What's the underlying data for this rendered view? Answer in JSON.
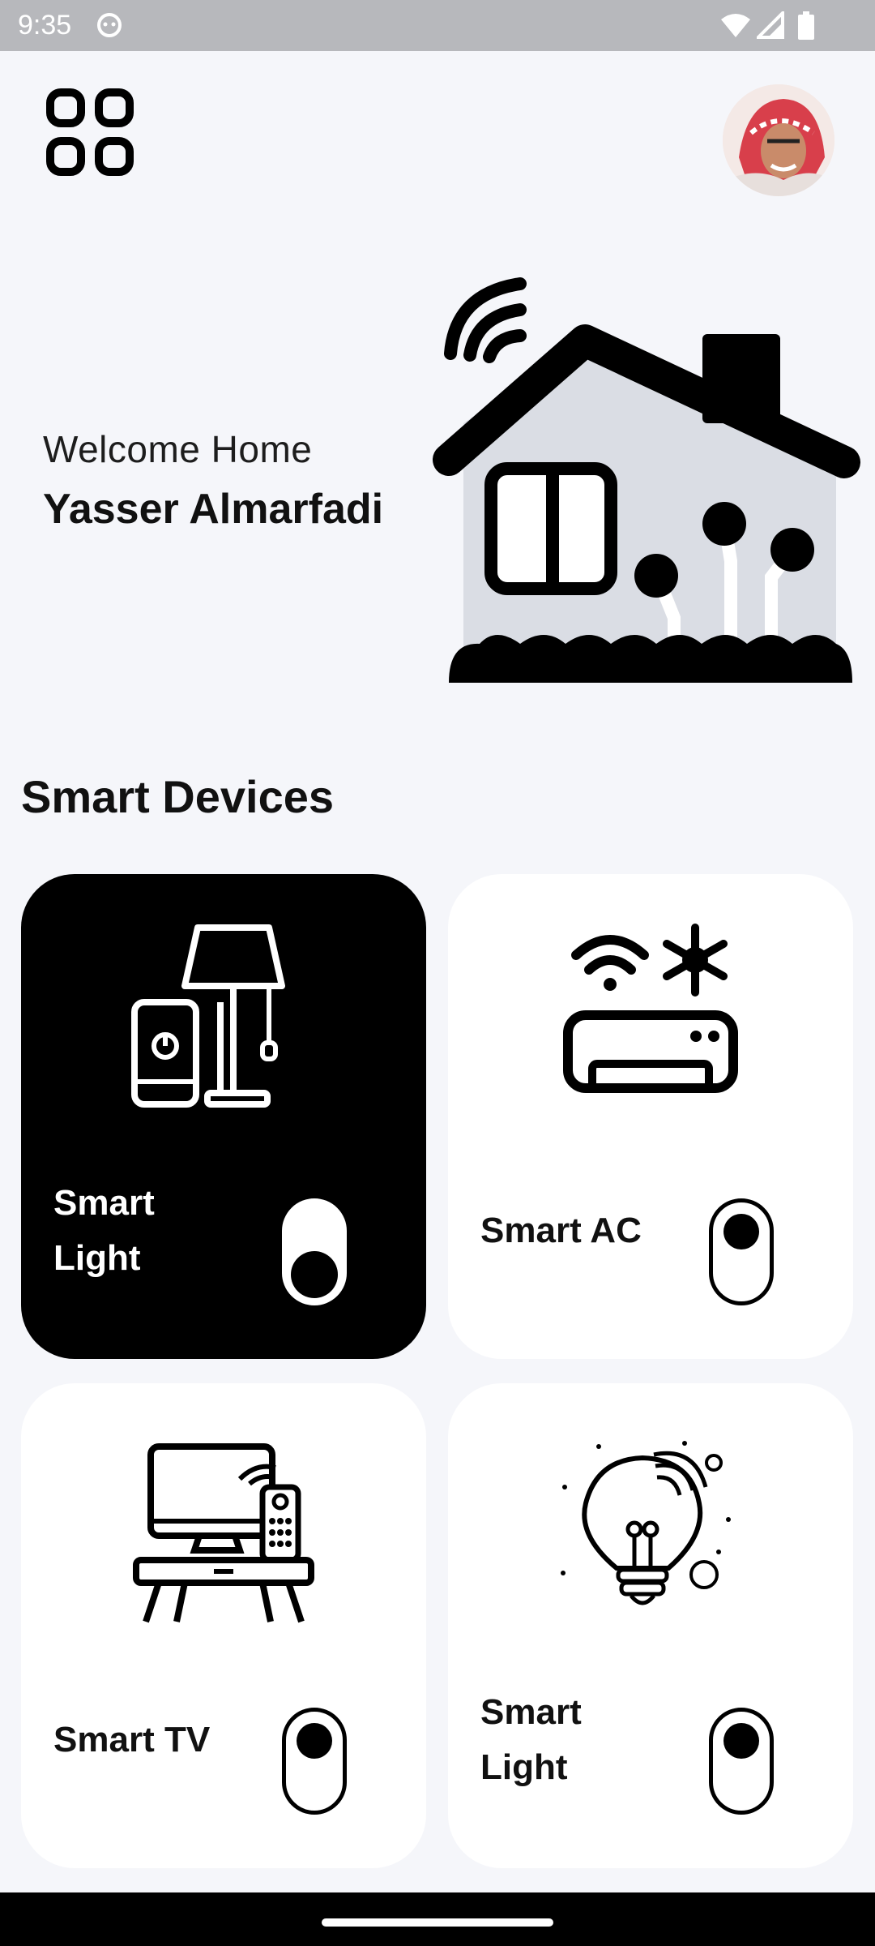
{
  "status_bar": {
    "time": "9:35"
  },
  "header": {
    "menu_icon": "grid-menu-icon",
    "avatar_icon": "user-avatar"
  },
  "hero": {
    "greeting": "Welcome Home",
    "user_name": "Yasser Almarfadi",
    "illustration": "smart-house-icon"
  },
  "devices": {
    "title": "Smart Devices",
    "items": [
      {
        "label": "Smart Light",
        "icon": "lamp-phone-icon",
        "on": true
      },
      {
        "label": "Smart AC",
        "icon": "air-conditioner-icon",
        "on": false
      },
      {
        "label": "Smart TV",
        "icon": "tv-remote-icon",
        "on": false
      },
      {
        "label": "Smart Light",
        "icon": "light-bulb-icon",
        "on": false
      }
    ]
  },
  "colors": {
    "background": "#f5f6fa",
    "active_card": "#000000",
    "card": "#ffffff",
    "accent": "#000000"
  }
}
